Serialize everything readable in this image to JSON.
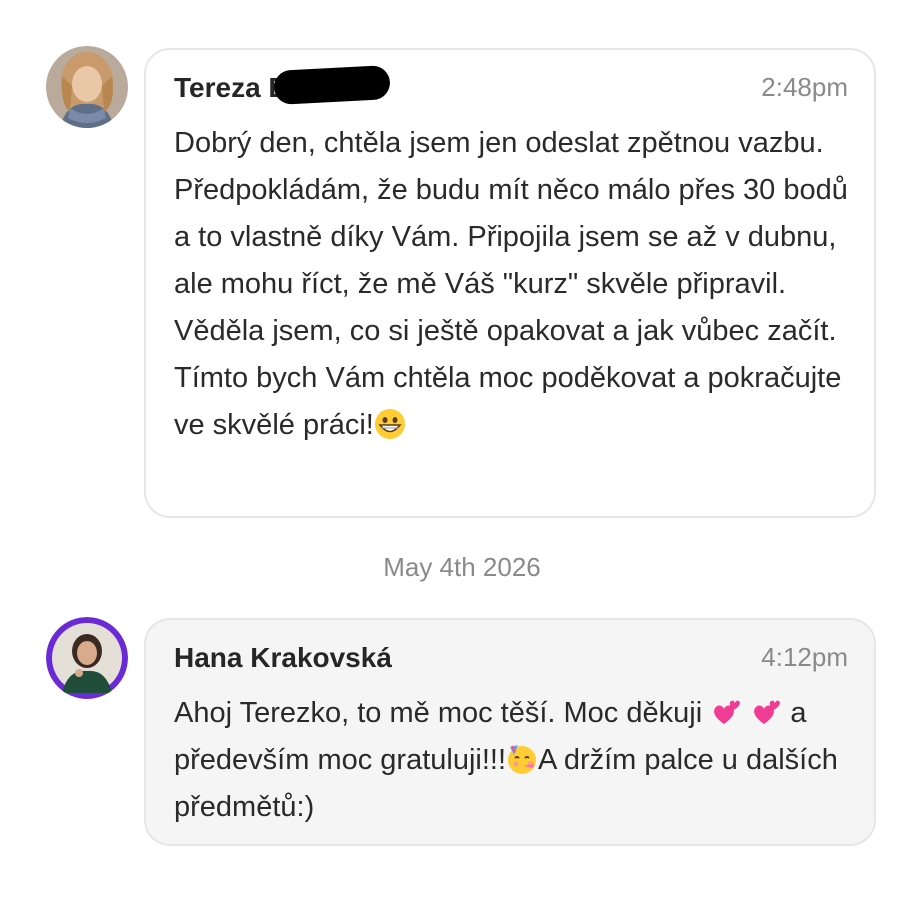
{
  "messages": [
    {
      "sender": "Tereza Bu",
      "time": "2:48pm",
      "text": "Dobrý den, chtěla jsem jen odeslat zpětnou vazbu. Předpokládám, že budu mít něco málo přes 30 bodů a to vlastně díky Vám. Připojila jsem se až v dubnu, ale mohu říct, že mě Váš \"kurz\" skvěle připravil. Věděla jsem, co si ještě opakovat a jak vůbec začít. Tímto bych Vám chtěla moc poděkovat a pokračujte ve skvělé práci!",
      "emoji_icon": "grinning-face-icon"
    },
    {
      "sender": "Hana Krakovská",
      "time": "4:12pm",
      "text_part1": "Ahoj Terezko, to mě moc těší. Moc děkuji ",
      "text_part2": " a především moc gratuluji!!!",
      "text_part3": "A držím palce u dalších předmětů:)",
      "emoji_icons": [
        "two-hearts-icon",
        "two-hearts-icon",
        "partying-face-icon"
      ]
    }
  ],
  "date_separator": "May 4th 2026",
  "colors": {
    "bubble_border": "#e6e6e6",
    "bubble_grey": "#f5f5f5",
    "avatar_ring": "#6a2bd6",
    "muted_text": "#8a8a8a"
  }
}
